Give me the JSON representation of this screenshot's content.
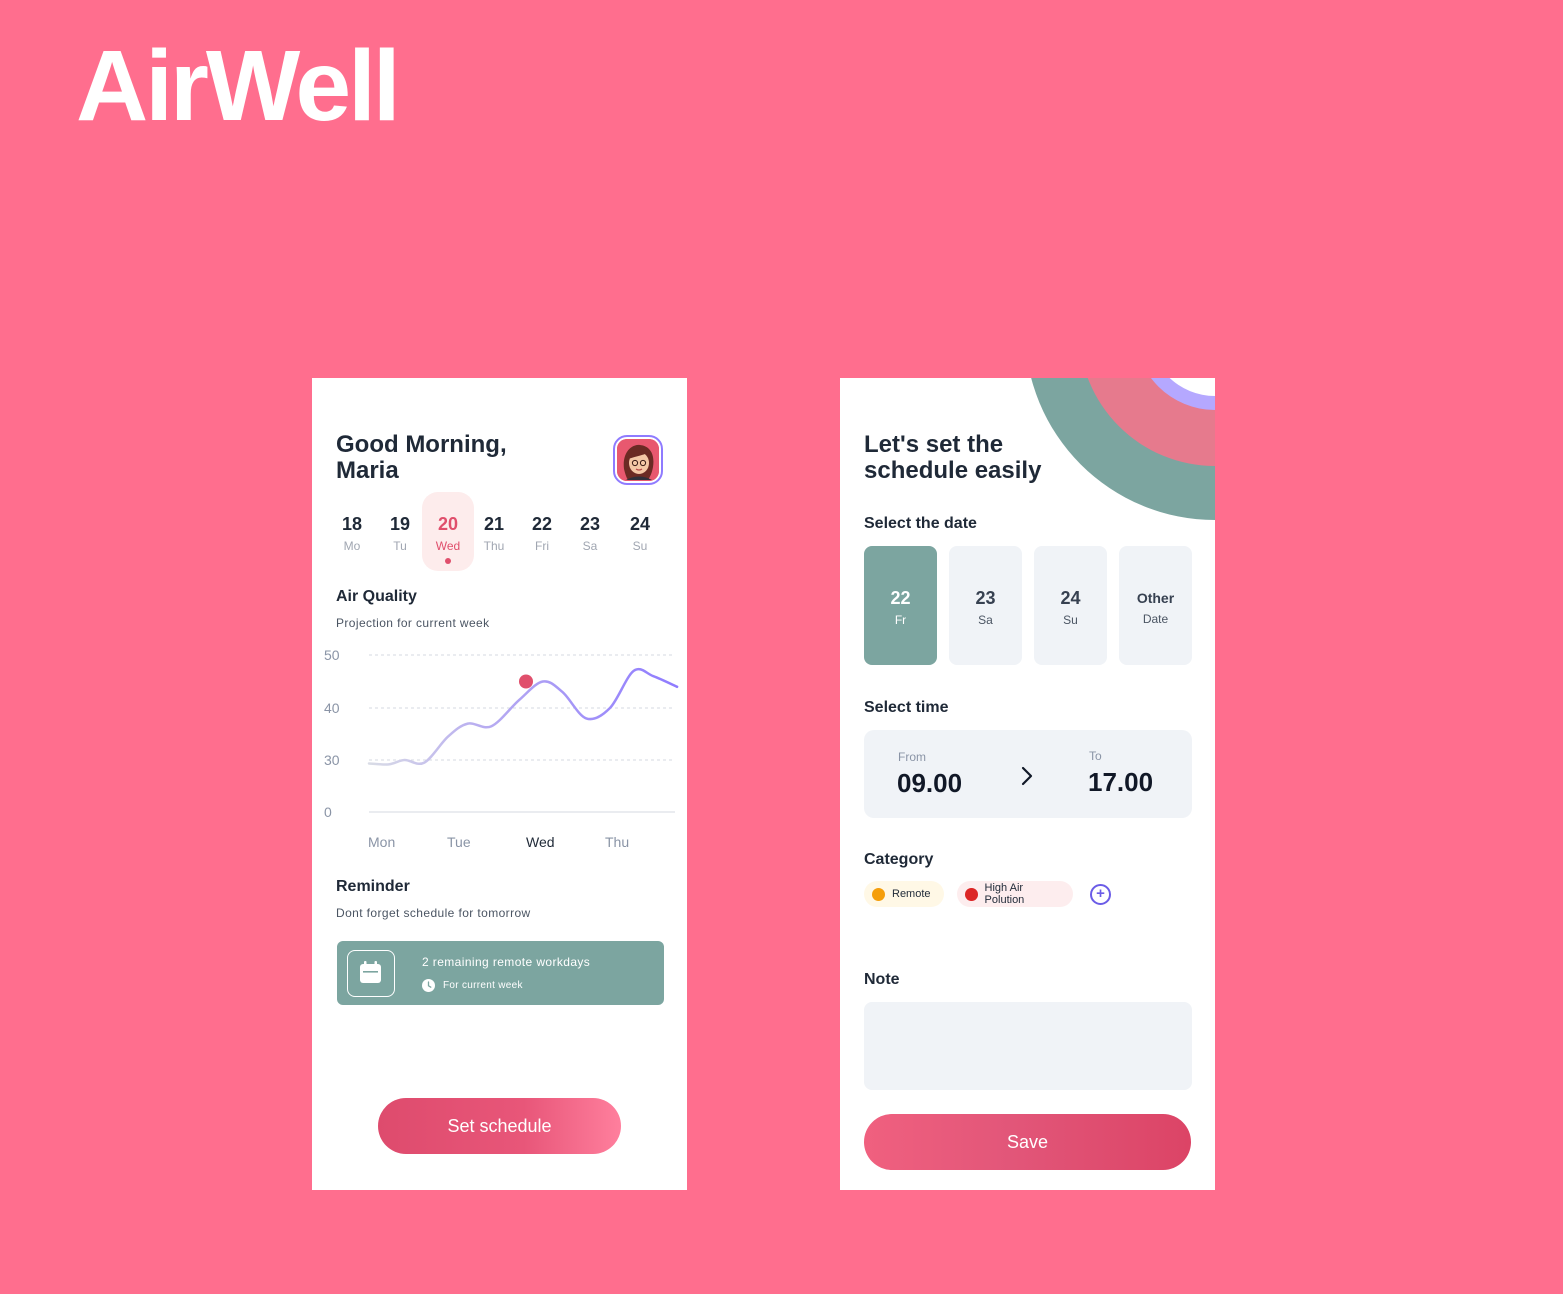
{
  "brand": "AirWell",
  "home": {
    "greeting_line1": "Good Morning,",
    "greeting_line2": "Maria",
    "days": [
      {
        "num": "18",
        "label": "Mo",
        "active": false
      },
      {
        "num": "19",
        "label": "Tu",
        "active": false
      },
      {
        "num": "20",
        "label": "Wed",
        "active": true
      },
      {
        "num": "21",
        "label": "Thu",
        "active": false
      },
      {
        "num": "22",
        "label": "Fri",
        "active": false
      },
      {
        "num": "23",
        "label": "Sa",
        "active": false
      },
      {
        "num": "24",
        "label": "Su",
        "active": false
      }
    ],
    "air_quality_title": "Air Quality",
    "air_quality_subtitle": "Projection for current week",
    "reminder_title": "Reminder",
    "reminder_subtitle": "Dont forget schedule for tomorrow",
    "reminder_card_title": "2 remaining remote workdays",
    "reminder_card_subtitle": "For current week",
    "set_schedule_label": "Set schedule"
  },
  "chart_data": {
    "type": "line",
    "title": "Air Quality",
    "y_ticks": [
      "50",
      "40",
      "30",
      "0"
    ],
    "x_ticks": [
      "Mon",
      "Tue",
      "Wed",
      "Thu"
    ],
    "highlighted_x": "Wed",
    "highlight_point": {
      "x": "Wed",
      "y": 45
    },
    "series": [
      {
        "x": [
          0,
          0.25,
          0.45,
          0.7,
          1.0,
          1.25,
          1.55,
          1.9,
          2.2,
          2.45,
          2.75,
          3.05,
          3.35,
          3.6,
          3.9
        ],
        "y": [
          28,
          27.5,
          30,
          28.5,
          34.5,
          37,
          36.5,
          41.5,
          45,
          43,
          38,
          40,
          47,
          46,
          44
        ]
      }
    ],
    "grid": "dashed-horizontal"
  },
  "schedule": {
    "title_line1": "Let's set the",
    "title_line2": "schedule easily",
    "select_date_label": "Select the date",
    "dates": [
      {
        "num": "22",
        "label": "Fr",
        "active": true
      },
      {
        "num": "23",
        "label": "Sa",
        "active": false
      },
      {
        "num": "24",
        "label": "Su",
        "active": false
      }
    ],
    "other_date_line1": "Other",
    "other_date_line2": "Date",
    "select_time_label": "Select time",
    "from_label": "From",
    "from_value": "09.00",
    "to_label": "To",
    "to_value": "17.00",
    "category_label": "Category",
    "categories": [
      {
        "label": "Remote",
        "color": "#F59E0B"
      },
      {
        "label": "High Air Polution",
        "color": "#DC2626"
      }
    ],
    "note_label": "Note",
    "note_value": "",
    "save_label": "Save"
  },
  "colors": {
    "background": "#FF6E8E",
    "accent_teal": "#7CA5A0",
    "accent_pink": "#E04F6C",
    "line_purple": "#8F7BFF"
  }
}
